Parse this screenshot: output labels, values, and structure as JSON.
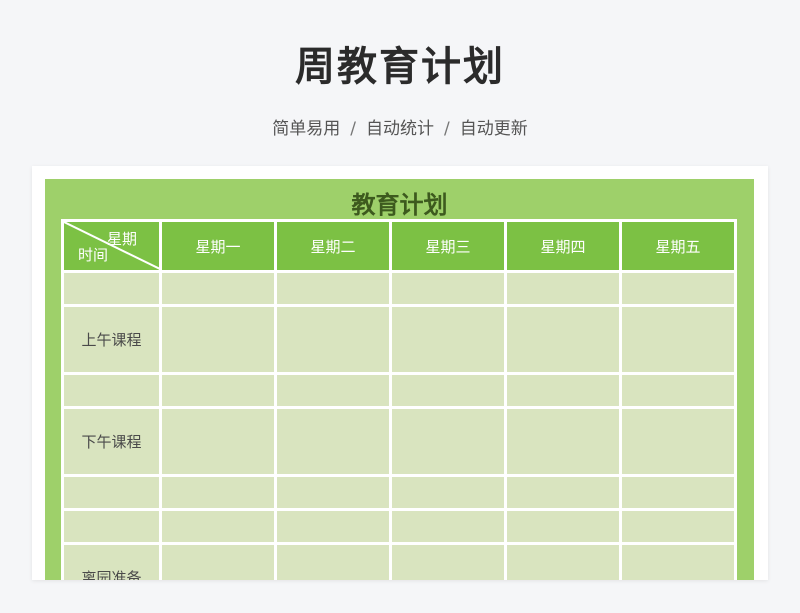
{
  "page": {
    "title": "周教育计划",
    "subtitle_parts": [
      "简单易用",
      "自动统计",
      "自动更新"
    ],
    "subtitle_sep": "/"
  },
  "sheet": {
    "title": "教育计划",
    "corner_top": "星期",
    "corner_bottom": "时间",
    "days": [
      "星期一",
      "星期二",
      "星期三",
      "星期四",
      "星期五"
    ],
    "row_labels": [
      "",
      "上午课程",
      "",
      "下午课程",
      "",
      "",
      "离园准备"
    ]
  },
  "colors": {
    "header_green": "#7cc144",
    "frame_green": "#9ed06a",
    "cell_green": "#d9e4bf",
    "title_dark": "#3d5a1e"
  }
}
